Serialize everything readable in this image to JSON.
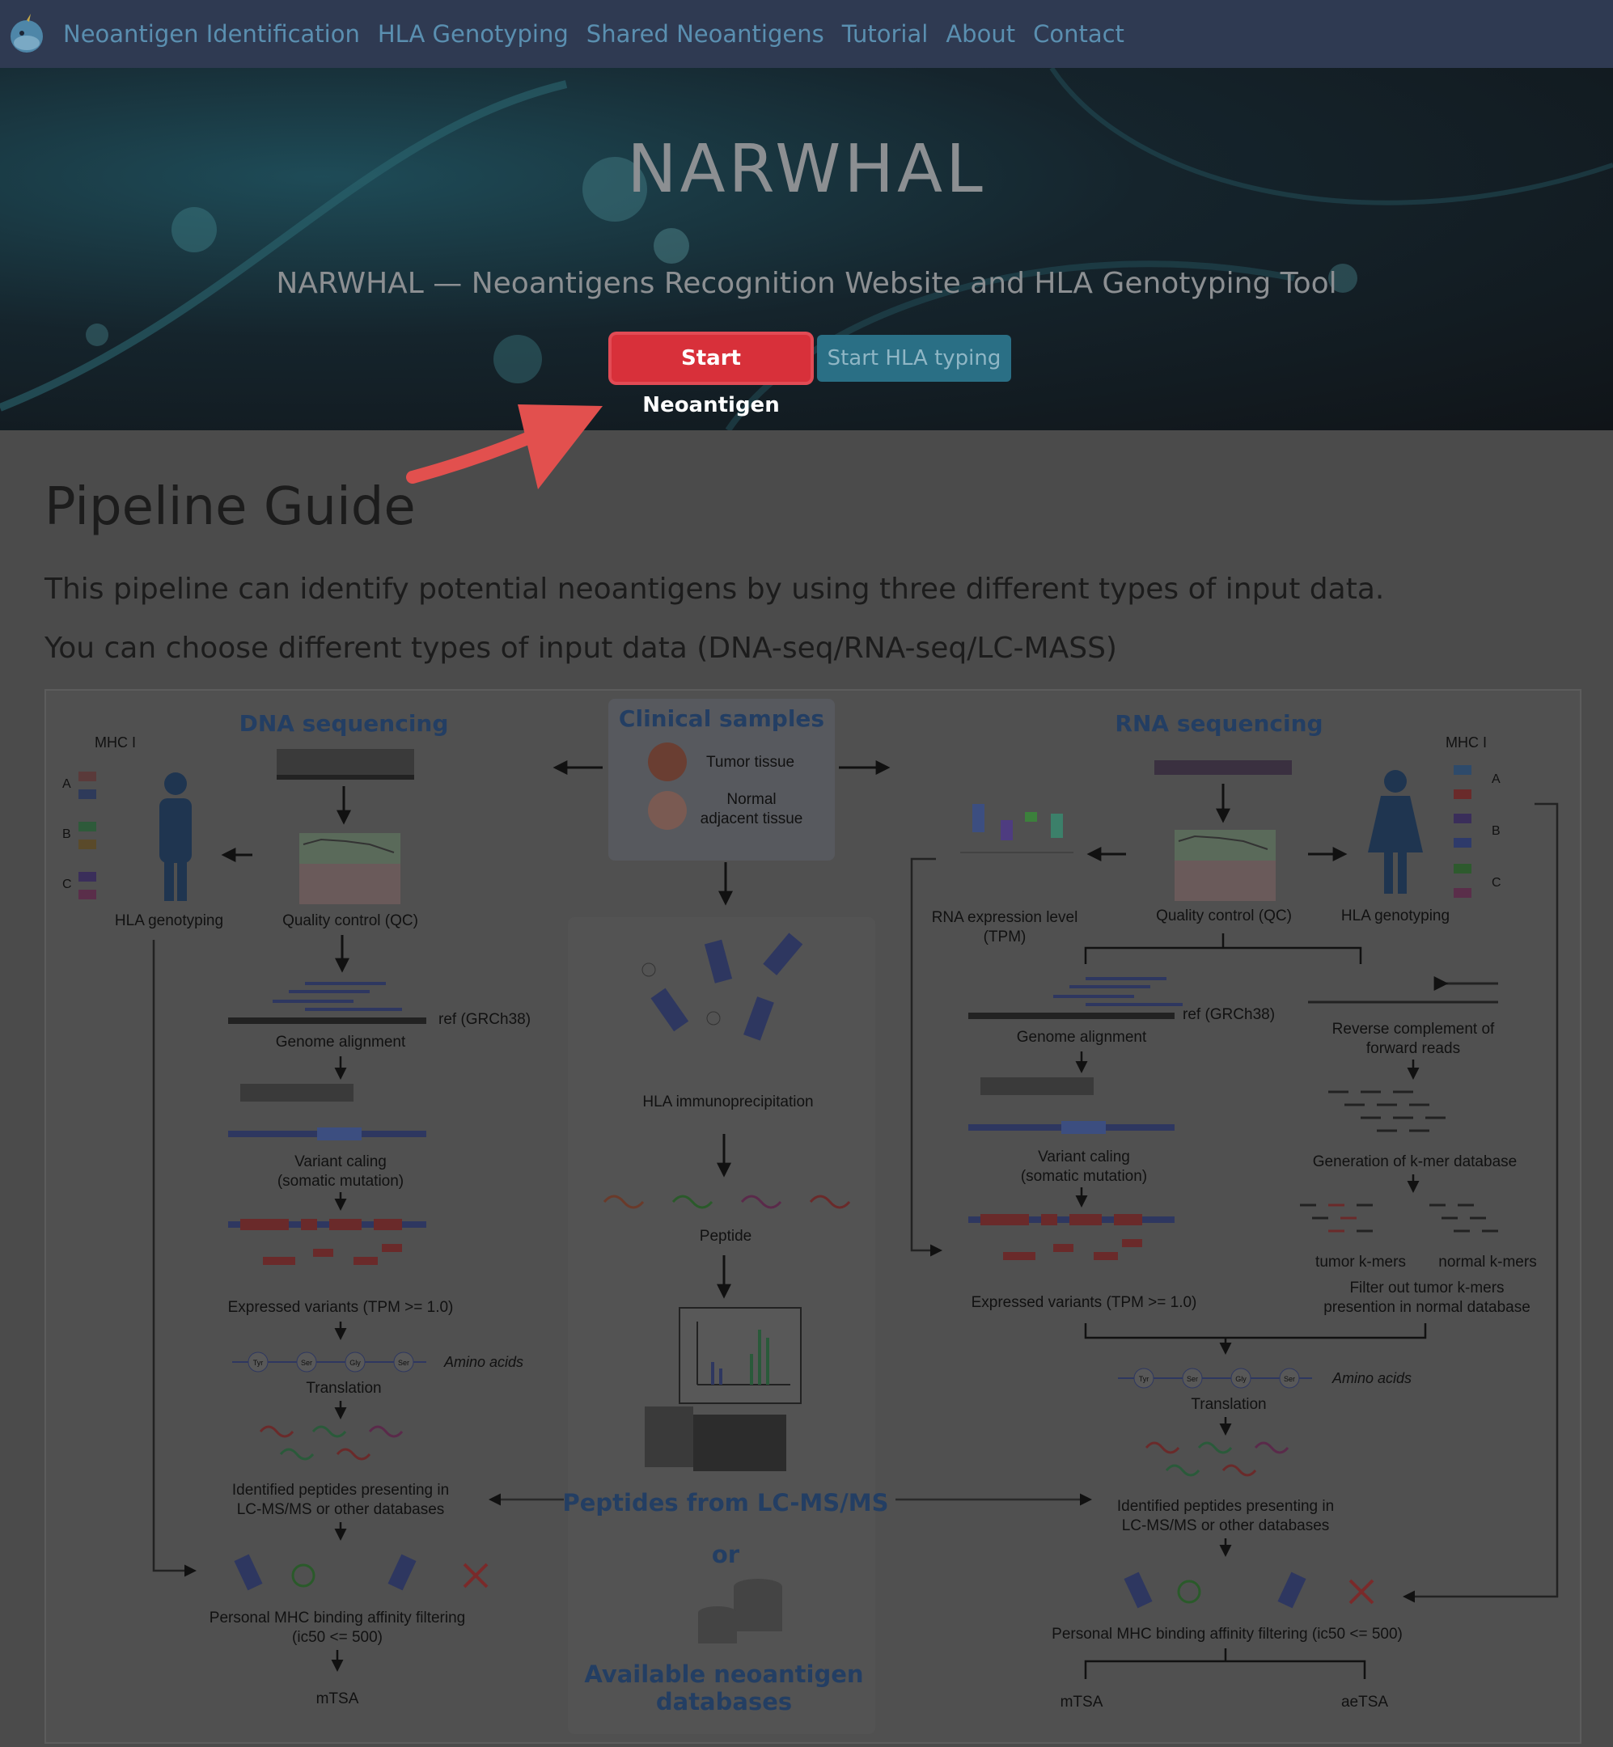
{
  "nav": {
    "items": [
      "Neoantigen Identification",
      "HLA Genotyping",
      "Shared Neoantigens",
      "Tutorial",
      "About",
      "Contact"
    ]
  },
  "hero": {
    "title": "NARWHAL",
    "subtitle": "NARWHAL — Neoantigens Recognition Website and HLA Genotyping Tool",
    "btn_neoantigen": "Start Neoantigen",
    "btn_hla": "Start HLA typing"
  },
  "guide": {
    "title": "Pipeline Guide",
    "para1": "This pipeline can identify potential neoantigens by using three different types of input data.",
    "para2": "You can choose different types of input data (DNA-seq/RNA-seq/LC-MASS)"
  },
  "figure": {
    "dna": {
      "title": "DNA sequencing",
      "mhc": "MHC I",
      "a": "A",
      "b": "B",
      "c": "C",
      "hla_genotyping": "HLA genotyping",
      "qc": "Quality control (QC)",
      "ref": "ref (GRCh38)",
      "alignment": "Genome alignment",
      "variant1": "Variant caling",
      "variant2": "(somatic mutation)",
      "expressed": "Expressed variants (TPM >= 1.0)",
      "amino": "Amino acids",
      "translation": "Translation",
      "identified1": "Identified peptides presenting in",
      "identified2": "LC-MS/MS or other databases",
      "binding1": "Personal MHC binding affinity filtering",
      "binding2": "(ic50 <= 500)",
      "out": "mTSA"
    },
    "center": {
      "title": "Clinical samples",
      "tumor": "Tumor tissue",
      "normal1": "Normal",
      "normal2": "adjacent tissue",
      "hla_ip": "HLA immunoprecipitation",
      "peptide": "Peptide",
      "lcms": "Peptides from LC-MS/MS",
      "or": "or",
      "db1": "Available neoantigen",
      "db2": "databases"
    },
    "rna": {
      "title": "RNA sequencing",
      "mhc": "MHC I",
      "a": "A",
      "b": "B",
      "c": "C",
      "expr1": "RNA expression level",
      "expr2": "(TPM)",
      "qc": "Quality control (QC)",
      "hla_genotyping": "HLA genotyping",
      "ref": "ref (GRCh38)",
      "alignment": "Genome alignment",
      "reverse1": "Reverse complement of",
      "reverse2": "forward reads",
      "variant1": "Variant caling",
      "variant2": "(somatic mutation)",
      "kmer_db": "Generation of k-mer database",
      "tumor_k": "tumor k-mers",
      "normal_k": "normal k-mers",
      "filter1": "Filter out tumor k-mers",
      "filter2": "presention in normal database",
      "expressed": "Expressed variants (TPM >= 1.0)",
      "amino": "Amino acids",
      "translation": "Translation",
      "identified1": "Identified peptides presenting in",
      "identified2": "LC-MS/MS or other databases",
      "binding": "Personal MHC binding affinity filtering (ic50 <= 500)",
      "out1": "mTSA",
      "out2": "aeTSA"
    },
    "aa": [
      "Tyr",
      "Ser",
      "Gly",
      "Ser"
    ]
  }
}
